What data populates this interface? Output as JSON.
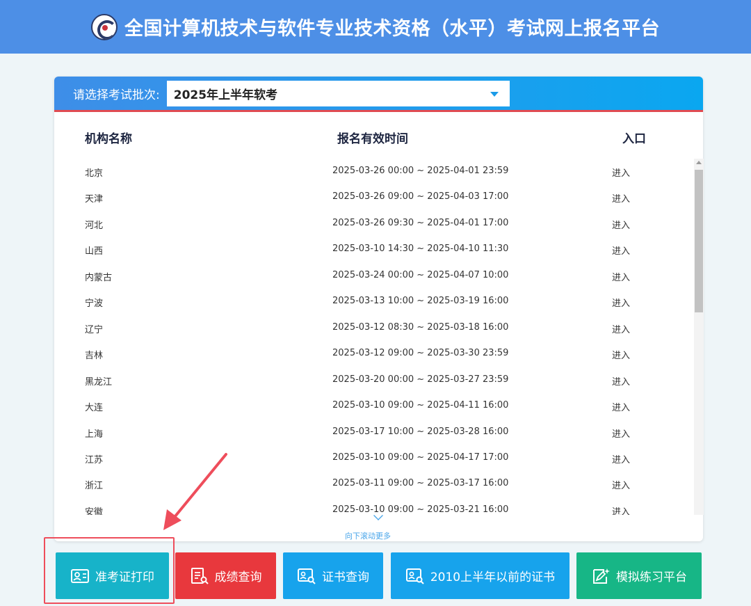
{
  "header": {
    "title": "全国计算机技术与软件专业技术资格（水平）考试网上报名平台"
  },
  "selector": {
    "label": "请选择考试批次:",
    "value": "2025年上半年软考"
  },
  "columns": {
    "name": "机构名称",
    "time": "报名有效时间",
    "entry": "入口"
  },
  "rows": [
    {
      "name": "北京",
      "time": "2025-03-26 00:00 ~ 2025-04-01 23:59",
      "entry": "进入"
    },
    {
      "name": "天津",
      "time": "2025-03-26 09:00 ~ 2025-04-03 17:00",
      "entry": "进入"
    },
    {
      "name": "河北",
      "time": "2025-03-26 09:30 ~ 2025-04-01 17:00",
      "entry": "进入"
    },
    {
      "name": "山西",
      "time": "2025-03-10 14:30 ~ 2025-04-10 11:30",
      "entry": "进入"
    },
    {
      "name": "内蒙古",
      "time": "2025-03-24 00:00 ~ 2025-04-07 10:00",
      "entry": "进入"
    },
    {
      "name": "宁波",
      "time": "2025-03-13 10:00 ~ 2025-03-19 16:00",
      "entry": "进入"
    },
    {
      "name": "辽宁",
      "time": "2025-03-12 08:30 ~ 2025-03-18 16:00",
      "entry": "进入"
    },
    {
      "name": "吉林",
      "time": "2025-03-12 09:00 ~ 2025-03-30 23:59",
      "entry": "进入"
    },
    {
      "name": "黑龙江",
      "time": "2025-03-20 00:00 ~ 2025-03-27 23:59",
      "entry": "进入"
    },
    {
      "name": "大连",
      "time": "2025-03-10 09:00 ~ 2025-04-11 16:00",
      "entry": "进入"
    },
    {
      "name": "上海",
      "time": "2025-03-17 10:00 ~ 2025-03-28 16:00",
      "entry": "进入"
    },
    {
      "name": "江苏",
      "time": "2025-03-10 09:00 ~ 2025-04-17 17:00",
      "entry": "进入"
    },
    {
      "name": "浙江",
      "time": "2025-03-11 09:00 ~ 2025-03-17 16:00",
      "entry": "进入"
    },
    {
      "name": "安徽",
      "time": "2025-03-10 09:00 ~ 2025-03-21 16:00",
      "entry": "进入"
    }
  ],
  "scroll_hint": "向下滚动更多",
  "buttons": {
    "admit": "准考证打印",
    "score": "成绩查询",
    "cert": "证书查询",
    "old_cert": "2010上半年以前的证书",
    "practice": "模拟练习平台"
  },
  "colors": {
    "header": "#4d8fe6",
    "highlight": "#ee4d5b",
    "admit": "#17b3c9",
    "score": "#e8383d",
    "cert": "#17a3ec",
    "practice": "#17b686"
  },
  "icons": {
    "admit": "id-card-icon",
    "score": "report-search-icon",
    "cert": "certificate-search-icon",
    "old_cert": "certificate-search-icon",
    "practice": "edit-sparkle-icon"
  }
}
